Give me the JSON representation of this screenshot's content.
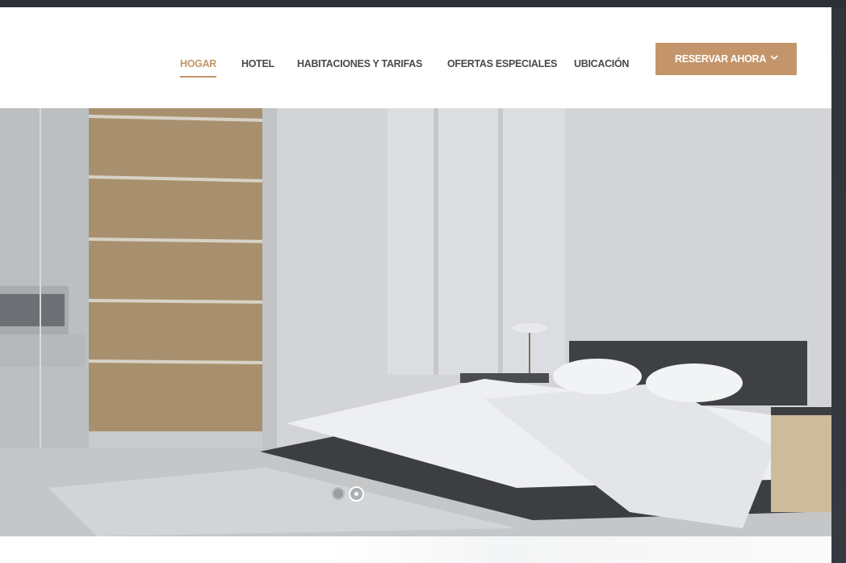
{
  "nav": {
    "items": [
      {
        "label": "HOGAR",
        "active": true
      },
      {
        "label": "HOTEL",
        "active": false
      },
      {
        "label": "HABITACIONES Y TARIFAS",
        "active": false
      },
      {
        "label": "OFERTAS ESPECIALES",
        "active": false
      },
      {
        "label": "UBICACIÓN",
        "active": false
      }
    ],
    "book_button": {
      "label": "RESERVAR AHORA",
      "icon": "chevron-down-icon"
    }
  },
  "slider": {
    "slide_count": 2,
    "active_slide": 2,
    "image": "hotel-bedroom"
  },
  "colors": {
    "accent": "#c4956a",
    "nav_text": "#4a4a4a",
    "header_bg": "#ffffff",
    "frame_dark": "#2c3238"
  }
}
